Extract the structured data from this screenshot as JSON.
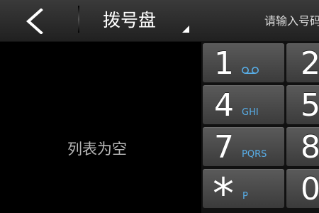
{
  "header": {
    "back_icon": "back-chevron-icon",
    "title": "拨号盘",
    "title_dropdown_icon": "dropdown-corner-icon",
    "search_placeholder": "请输入号码"
  },
  "list": {
    "empty_message": "列表为空"
  },
  "keypad": {
    "keys": [
      {
        "digit": "1",
        "letters": "",
        "icon": "voicemail-icon"
      },
      {
        "digit": "2",
        "letters": ""
      },
      {
        "digit": "4",
        "letters": "GHI"
      },
      {
        "digit": "5",
        "letters": ""
      },
      {
        "digit": "7",
        "letters": "PQRS"
      },
      {
        "digit": "8",
        "letters": ""
      },
      {
        "digit": "*",
        "letters": "P"
      },
      {
        "digit": "0",
        "letters": ""
      }
    ]
  },
  "colors": {
    "accent": "#58aee8",
    "key_bg": "#4a4a4a",
    "header_bg": "#2c2c2c"
  }
}
